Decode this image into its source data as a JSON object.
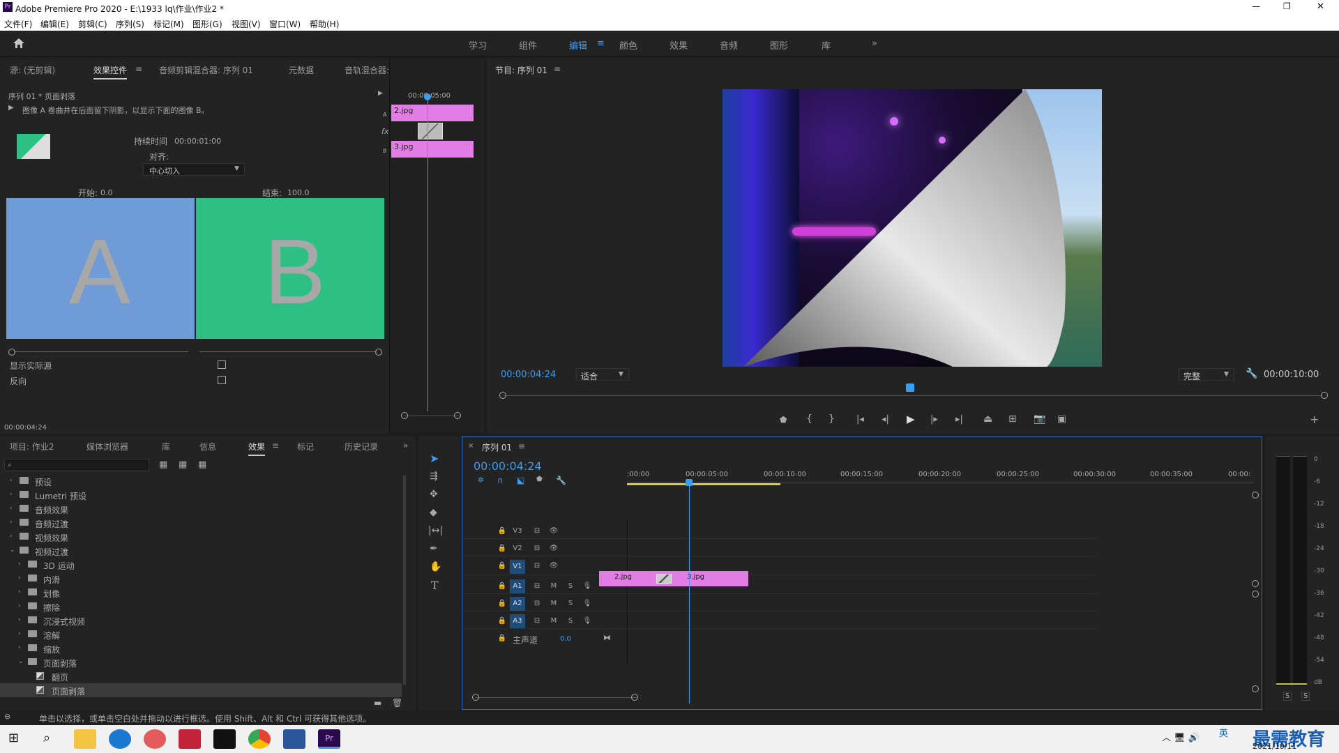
{
  "app": {
    "title": "Adobe Premiere Pro 2020 - E:\\1933 lq\\作业\\作业2 *",
    "logo": "Pr"
  },
  "menu": [
    "文件(F)",
    "编辑(E)",
    "剪辑(C)",
    "序列(S)",
    "标记(M)",
    "图形(G)",
    "视图(V)",
    "窗口(W)",
    "帮助(H)"
  ],
  "workspaces": [
    "学习",
    "组件",
    "编辑",
    "颜色",
    "效果",
    "音频",
    "图形",
    "库"
  ],
  "workspace_active": "编辑",
  "effect_controls": {
    "tabs": [
      "源: (无剪辑)",
      "效果控件",
      "音频剪辑混合器: 序列 01",
      "元数据",
      "音轨混合器: 序列 01"
    ],
    "active_tab": "效果控件",
    "clip_title": "序列 01 * 页面剥落",
    "description": "图像 A 卷曲并在后面留下阴影，以显示下面的图像 B。",
    "duration_label": "持续时间",
    "duration_value": "00:00:01:00",
    "align_label": "对齐:",
    "align_value": "中心切入",
    "start_label": "开始:",
    "start_value": "0.0",
    "end_label": "结束:",
    "end_value": "100.0",
    "preview_a": "A",
    "preview_b": "B",
    "show_actual_label": "显示实际源",
    "reverse_label": "反向",
    "mini_time": "00:00:05:00",
    "clip_a": "2.jpg",
    "clip_b": "3.jpg",
    "track_a": "A",
    "track_b": "B",
    "fx_label": "fx",
    "current_time": "00:00:04:24"
  },
  "program": {
    "title": "节目: 序列 01",
    "current_time": "00:00:04:24",
    "fit": "适合",
    "quality": "完整",
    "duration": "00:00:10:00",
    "playhead_fraction": 0.495
  },
  "project": {
    "tabs": [
      "项目: 作业2",
      "媒体浏览器",
      "库",
      "信息",
      "效果",
      "标记",
      "历史记录"
    ],
    "active_tab": "效果",
    "tree": [
      {
        "label": "预设",
        "indent": 0,
        "open": false,
        "kind": "folder"
      },
      {
        "label": "Lumetri 预设",
        "indent": 0,
        "open": false,
        "kind": "folder"
      },
      {
        "label": "音频效果",
        "indent": 0,
        "open": false,
        "kind": "folder"
      },
      {
        "label": "音频过渡",
        "indent": 0,
        "open": false,
        "kind": "folder"
      },
      {
        "label": "视频效果",
        "indent": 0,
        "open": false,
        "kind": "folder"
      },
      {
        "label": "视频过渡",
        "indent": 0,
        "open": true,
        "kind": "folder"
      },
      {
        "label": "3D 运动",
        "indent": 1,
        "open": false,
        "kind": "folder"
      },
      {
        "label": "内滑",
        "indent": 1,
        "open": false,
        "kind": "folder"
      },
      {
        "label": "划像",
        "indent": 1,
        "open": false,
        "kind": "folder"
      },
      {
        "label": "擦除",
        "indent": 1,
        "open": false,
        "kind": "folder"
      },
      {
        "label": "沉浸式视频",
        "indent": 1,
        "open": false,
        "kind": "folder"
      },
      {
        "label": "溶解",
        "indent": 1,
        "open": false,
        "kind": "folder"
      },
      {
        "label": "缩放",
        "indent": 1,
        "open": false,
        "kind": "folder"
      },
      {
        "label": "页面剥落",
        "indent": 1,
        "open": true,
        "kind": "folder"
      },
      {
        "label": "翻页",
        "indent": 2,
        "open": false,
        "kind": "fx"
      },
      {
        "label": "页面剥落",
        "indent": 2,
        "open": false,
        "kind": "fx",
        "selected": true
      }
    ]
  },
  "timeline": {
    "title": "序列 01",
    "current_time": "00:00:04:24",
    "ruler": [
      ":00:00",
      "00:00:05:00",
      "00:00:10:00",
      "00:00:15:00",
      "00:00:20:00",
      "00:00:25:00",
      "00:00:30:00",
      "00:00:35:00",
      "00:00:"
    ],
    "video_tracks": [
      "V3",
      "V2",
      "V1"
    ],
    "audio_tracks": [
      "A1",
      "A2",
      "A3"
    ],
    "mute": "M",
    "solo": "S",
    "master_label": "主声道",
    "master_value": "0.0",
    "clips": [
      "2.jpg",
      "3.jpg"
    ]
  },
  "meter": {
    "labels": [
      "0",
      "-6",
      "-12",
      "-18",
      "-24",
      "-30",
      "-36",
      "-42",
      "-48",
      "-54",
      "dB"
    ],
    "solo": [
      "S",
      "S"
    ]
  },
  "status": "单击以选择，或单击空白处并拖动以进行框选。使用 Shift、Alt 和 Ctrl 可获得其他选项。",
  "taskbar": {
    "ime": "英",
    "brand": "最需教育",
    "date": "2021/10/11",
    "window_controls": [
      "—",
      "❐",
      "✕"
    ]
  }
}
